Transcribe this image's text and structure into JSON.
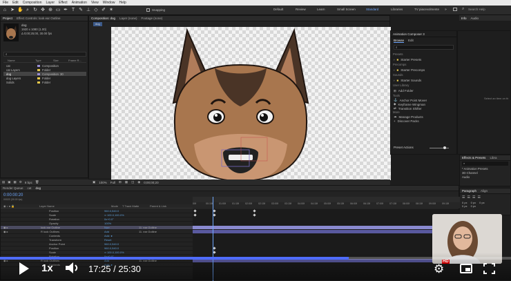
{
  "menu": [
    "File",
    "Edit",
    "Composition",
    "Layer",
    "Effect",
    "Animation",
    "View",
    "Window",
    "Help"
  ],
  "toolbar": {
    "snapping_label": "Snapping",
    "workspaces": [
      "Default",
      "Review",
      "Learn",
      "Small Screen",
      "Standard",
      "Libraries",
      "TV piacevolmente"
    ],
    "search_placeholder": "Search Help"
  },
  "project": {
    "tabs": [
      "Project",
      "Effect Controls: look ear Outline"
    ],
    "item_name": "dog",
    "item_info1": "1920 x 1080 (1.00)",
    "item_info2": "Δ 0;00;25;00, 30.00 fps",
    "search_placeholder": "⌕",
    "columns": [
      "Name",
      "Type",
      "Size",
      "Frame R..."
    ],
    "rows": [
      {
        "name": "cat",
        "type": "Composition",
        "size": "",
        "swatch": "#9a8fd6"
      },
      {
        "name": "cat Layers",
        "type": "Folder",
        "size": "",
        "swatch": "#e6c84a"
      },
      {
        "name": "dog",
        "type": "Composition",
        "size": "30",
        "swatch": "#9a8fd6"
      },
      {
        "name": "dog Layers",
        "type": "Folder",
        "size": "",
        "swatch": "#e6c84a"
      },
      {
        "name": "Solids",
        "type": "Folder",
        "size": "",
        "swatch": "#e6c84a"
      }
    ],
    "footer_bpc": "8 bpc"
  },
  "composition": {
    "tabs": [
      "Composition: dog",
      "Layer (none)",
      "Footage (none)"
    ],
    "subtab": "dog",
    "zoom": "100%",
    "quality": "Full",
    "timecode": "0;00;00;20"
  },
  "animation_composer": {
    "title": "Animation Composer 3",
    "tabs": [
      "Browse",
      "Edit"
    ],
    "sections": [
      {
        "heading": "Presets",
        "items": [
          "Starter Presets"
        ]
      },
      {
        "heading": "Precomps",
        "items": [
          "Starter Precomps"
        ]
      },
      {
        "heading": "Sounds",
        "items": [
          "Starter Sounds"
        ]
      },
      {
        "heading": "User Library",
        "items": [
          "Add Folder"
        ]
      },
      {
        "heading": "Tools",
        "items": [
          "Anchor Point Mover",
          "Keyframe Wingman",
          "Transition Shifter"
        ]
      },
      {
        "heading": "More",
        "items": [
          "Manage Products",
          "Discover Packs"
        ]
      }
    ],
    "select_hint": "Select an item on th",
    "preset_actions_label": "Preset Actions"
  },
  "info_panel": {
    "tabs": [
      "Info",
      "Audio"
    ]
  },
  "effects_presets": {
    "tabs": [
      "Effects & Presets",
      "Libra"
    ],
    "search_placeholder": "⌕",
    "items": [
      "* Animation Presets",
      "3D Channel",
      "Audio"
    ]
  },
  "paragraph": {
    "tabs": [
      "Paragraph",
      "Align"
    ],
    "values": [
      "0 px",
      "0 px",
      "0 px",
      "0 px",
      "0 px"
    ]
  },
  "timeline": {
    "tabs": [
      "Render Queue",
      "cat",
      "dog"
    ],
    "timecode": "0:00:00:20",
    "timecode_sub": "00020 (30.00 fps)",
    "columns": [
      "Layer Name",
      "Mode",
      "T Track Matte",
      "Parent & Link"
    ],
    "ruler": [
      "00f",
      "00:15f",
      "01:00f",
      "01:15f",
      "02:00f",
      "02:15f",
      "03:00f",
      "03:15f",
      "04:00f",
      "04:15f",
      "05:00f",
      "05:15f",
      "06:00f",
      "06:15f",
      "07:00f",
      "07:15f",
      "08:00f",
      "08:15f",
      "09:00f",
      "09:15f"
    ],
    "rows": [
      {
        "name": "Position",
        "value": "960.0,540.0",
        "style": "prop"
      },
      {
        "name": "Scale",
        "value": "∞ 100.0,100.0%",
        "style": "prop"
      },
      {
        "name": "Rotation",
        "value": "0x+0.0°",
        "style": "prop"
      },
      {
        "name": "Opacity",
        "value": "100%",
        "style": "prop"
      },
      {
        "name": "look ear Outline",
        "value": "Norr",
        "parent": "11. ear Outline",
        "style": "layer-sel"
      },
      {
        "name": "R look Outlines",
        "value": "Add",
        "parent": "11. ear Outline",
        "style": "layer"
      },
      {
        "name": "Contents",
        "value": "Add: ●",
        "style": "prop"
      },
      {
        "name": "Transform",
        "value": "Reset",
        "style": "prop"
      },
      {
        "name": "Anchor Point",
        "value": "960.0,540.0",
        "style": "prop"
      },
      {
        "name": "Position",
        "value": "960.0,540.0",
        "style": "prop"
      },
      {
        "name": "Scale",
        "value": "∞ 100.0,100.0%",
        "style": "prop"
      },
      {
        "name": "Rotation",
        "value": "0x+0.0°",
        "style": "prop"
      },
      {
        "name": "R look Outlines",
        "value": "Add",
        "parent": "11. ear Outline",
        "style": "layer"
      },
      {
        "name": "Contents",
        "value": "Add: ●",
        "style": "prop"
      }
    ]
  },
  "player": {
    "speed_label": "1x",
    "time": "17:25 / 25:30",
    "hd_badge": "HD",
    "progress": 0.683
  }
}
